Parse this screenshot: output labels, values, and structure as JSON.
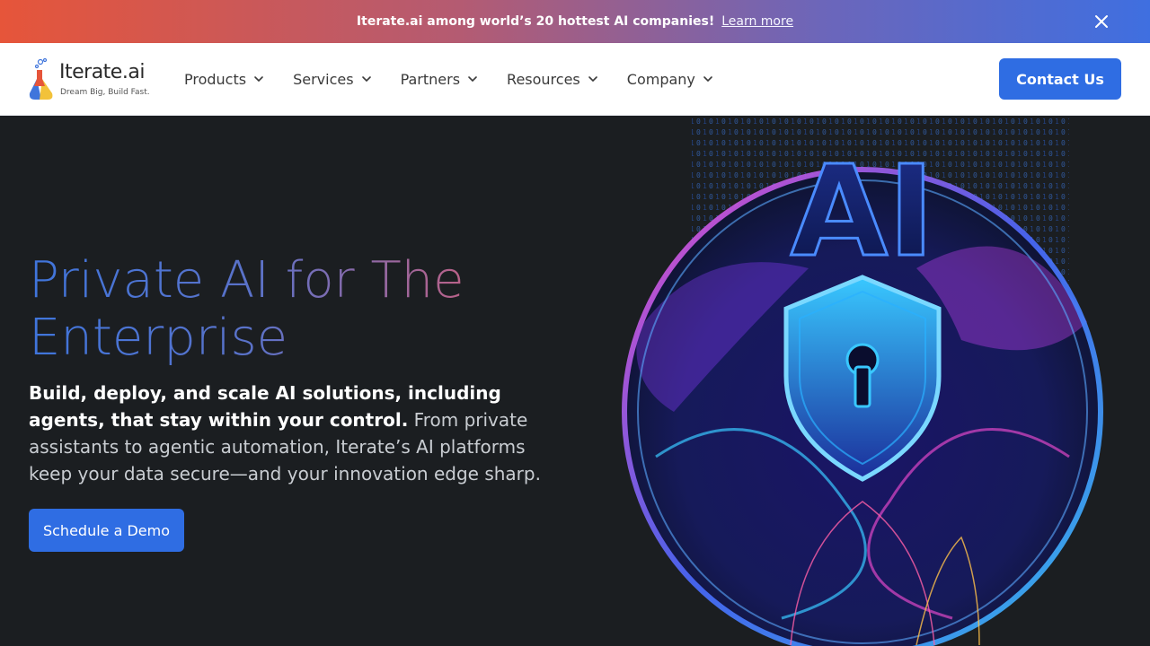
{
  "banner": {
    "message": "Iterate.ai among world’s 20 hottest AI companies!",
    "link": "Learn more"
  },
  "logo": {
    "brand": "Iterate.",
    "brand_suffix": "ai",
    "tagline": "Dream Big, Build Fast."
  },
  "nav": {
    "items": [
      {
        "label": "Products"
      },
      {
        "label": "Services"
      },
      {
        "label": "Partners"
      },
      {
        "label": "Resources"
      },
      {
        "label": "Company"
      }
    ],
    "contact": "Contact Us"
  },
  "hero": {
    "title": "Private AI for The Enterprise",
    "subtitle_strong": "Build, deploy, and scale AI solutions, including agents, that stay within your control.",
    "subtitle_rest": " From private assistants to agentic automation, Iterate’s AI platforms keep your data secure—and your innovation edge sharp.",
    "cta": "Schedule a Demo",
    "art_text": "AI"
  },
  "colors": {
    "accent": "#2f6de3",
    "background": "#1b1e21",
    "banner_start": "#e6553a",
    "banner_end": "#3f6fe0"
  },
  "icons": {
    "close": "close-icon",
    "chevron": "chevron-down-icon",
    "logo": "flask-logo-icon",
    "shield": "shield-keyhole-icon"
  }
}
